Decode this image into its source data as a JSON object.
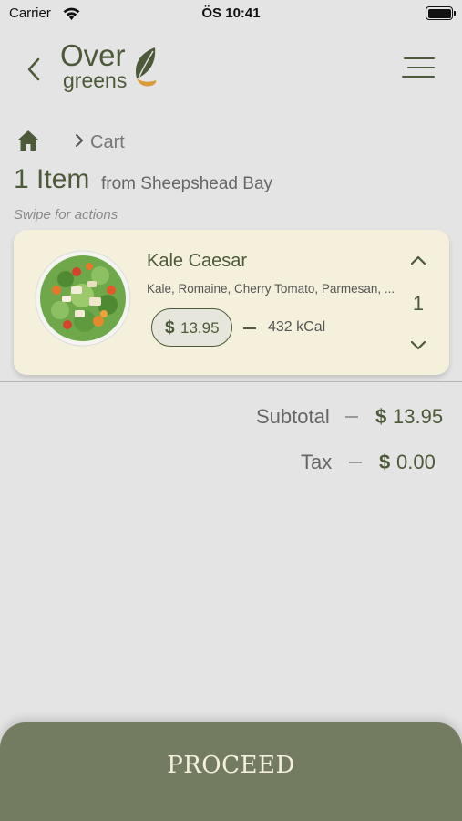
{
  "status_bar": {
    "carrier": "Carrier",
    "time": "ÖS 10:41"
  },
  "header": {
    "logo_line1": "Over",
    "logo_line2": "greens",
    "back_icon": "chevron-left-icon",
    "menu_icon": "hamburger-menu-icon"
  },
  "breadcrumb": {
    "home_icon": "home-icon",
    "current": "Cart"
  },
  "cart": {
    "items_count": "1 Item",
    "from_location": "from Sheepshead Bay",
    "swipe_hint": "Swipe for actions",
    "items": [
      {
        "name": "Kale Caesar",
        "description": "Kale, Romaine, Cherry Tomato, Parmesan, ...",
        "price_symbol": "$",
        "price": "13.95",
        "calories": "432 kCal",
        "quantity": "1"
      }
    ]
  },
  "summary": {
    "subtotal_label": "Subtotal",
    "subtotal_symbol": "$",
    "subtotal_value": "13.95",
    "tax_label": "Tax",
    "tax_symbol": "$",
    "tax_value": "0.00"
  },
  "actions": {
    "proceed_label": "PROCEED"
  },
  "colors": {
    "background": "#e4e4e4",
    "brand_green": "#4d5a39",
    "card_bg": "#f5f0dc",
    "proceed_bg": "#737c60",
    "proceed_text": "#f4f0dc"
  }
}
